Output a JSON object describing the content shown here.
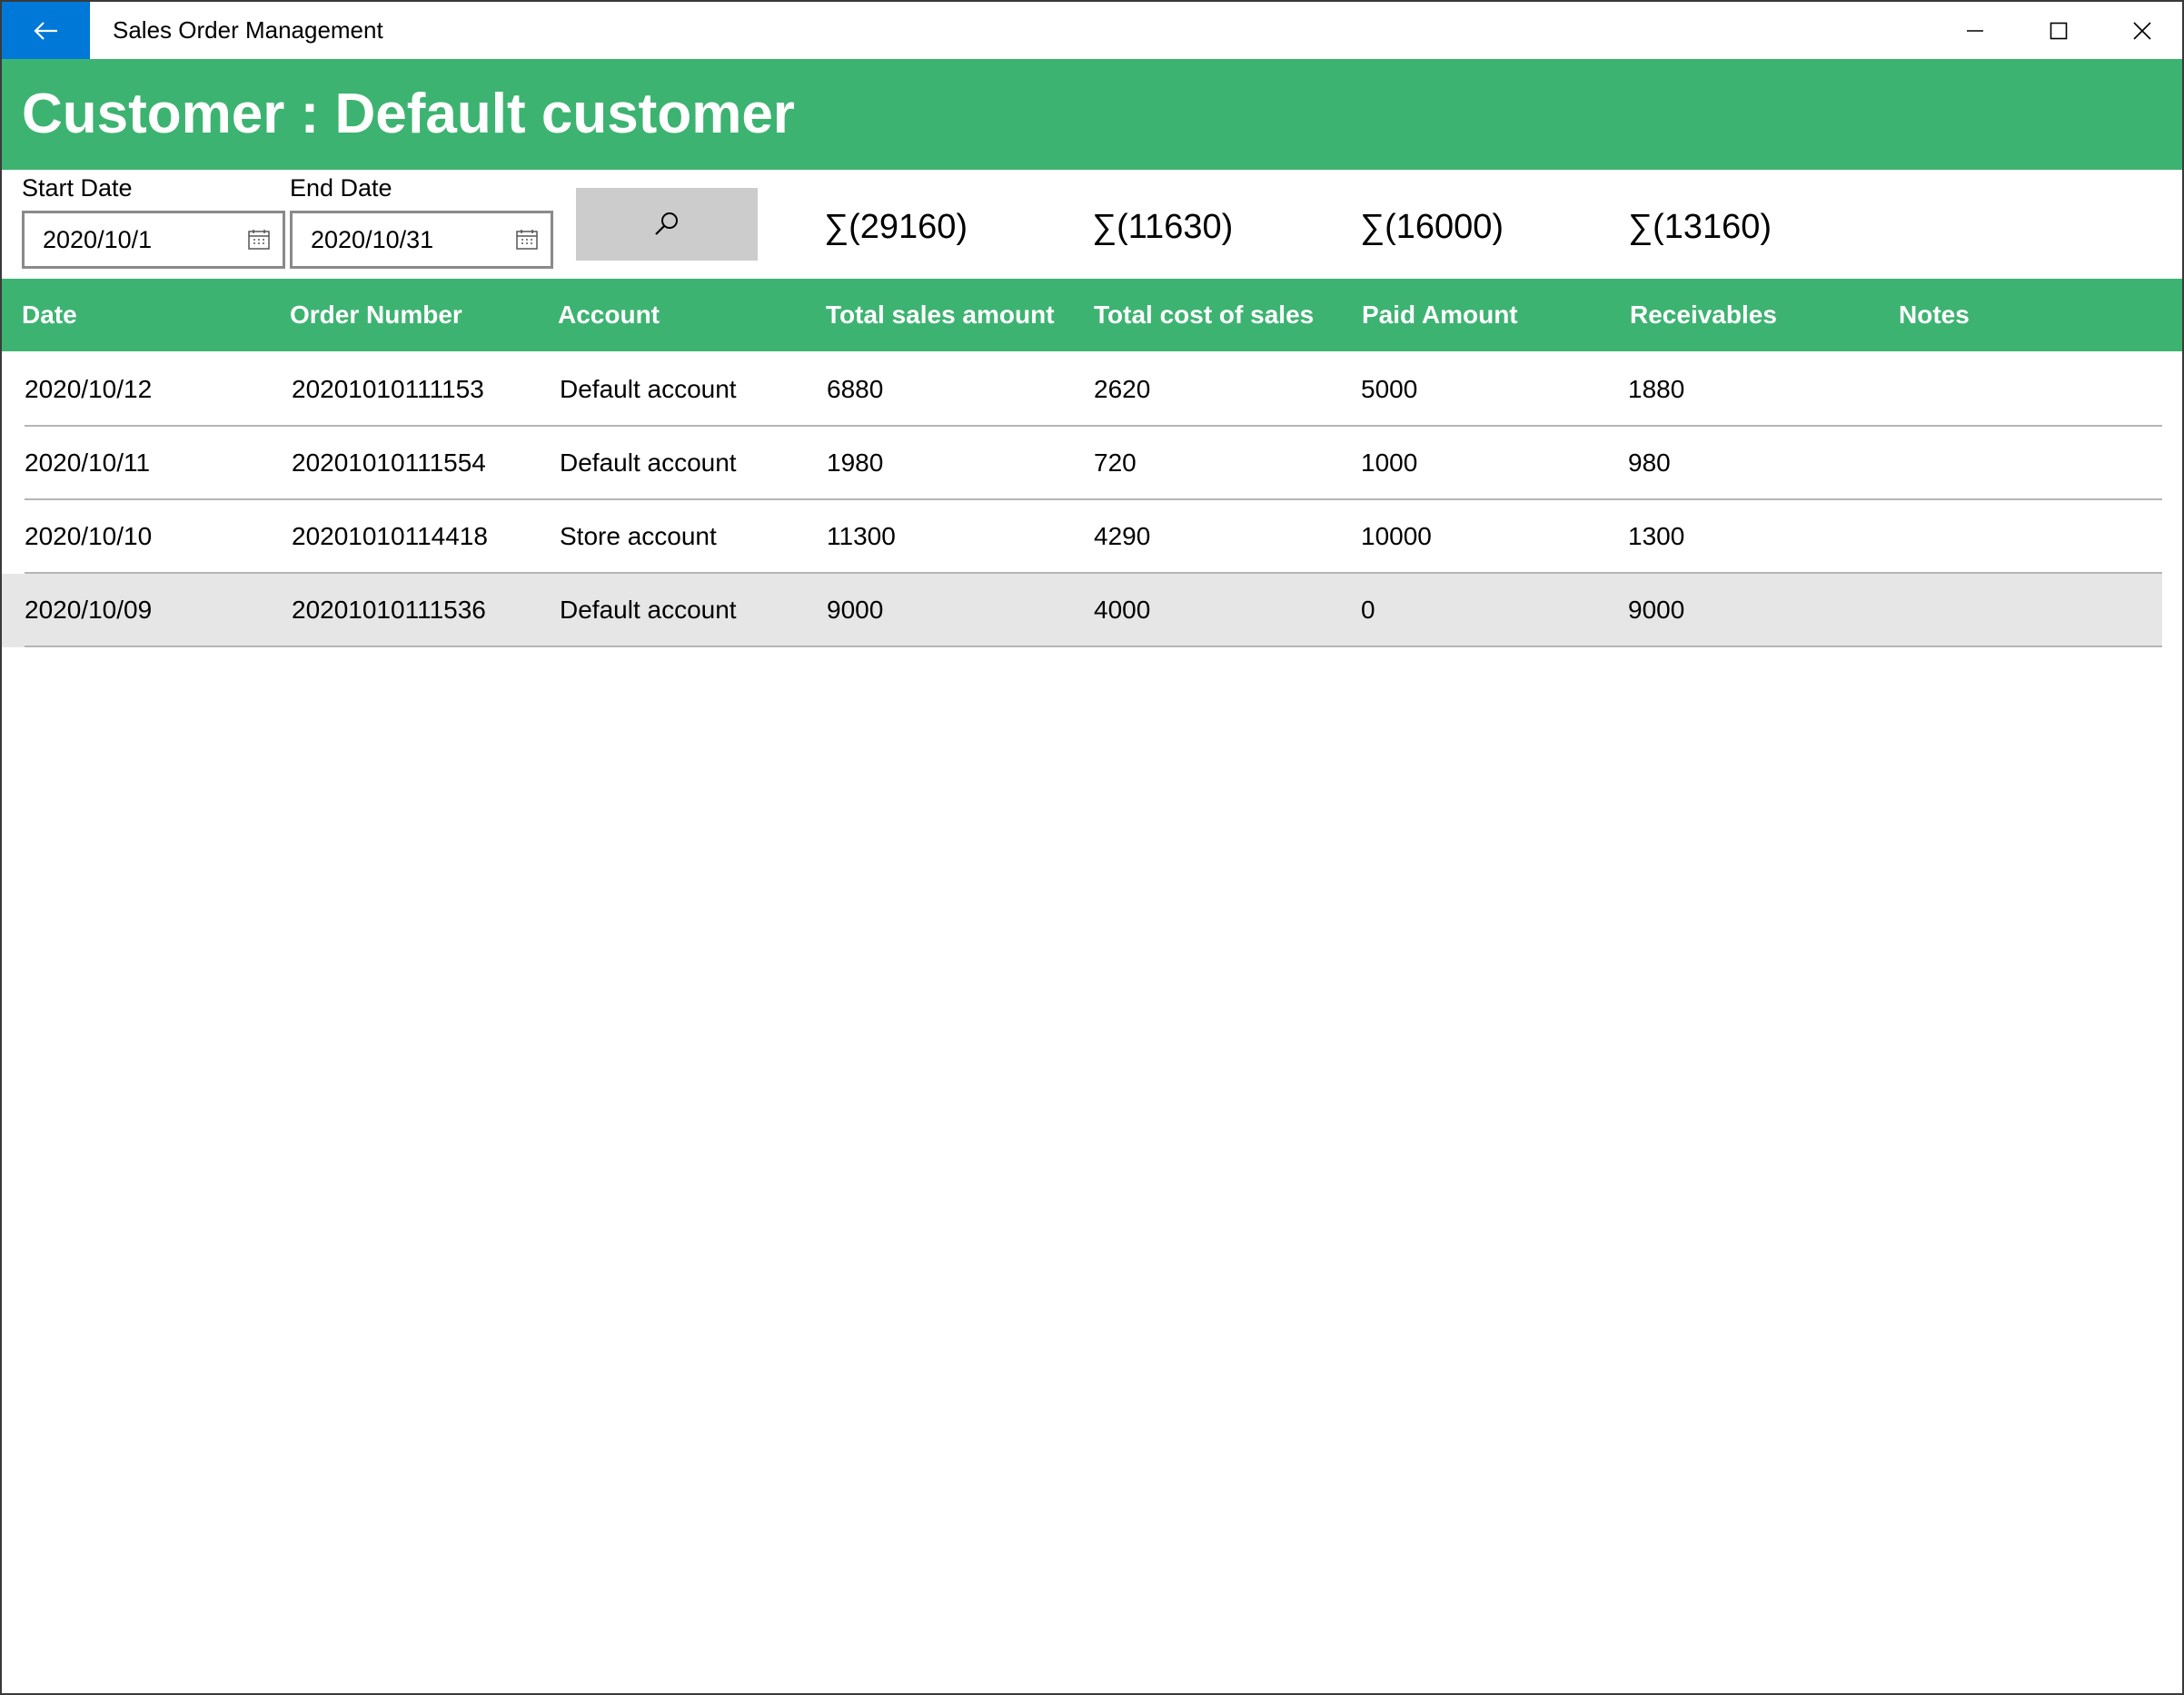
{
  "window": {
    "app_title": "Sales Order Management"
  },
  "colors": {
    "accent": "#3db371",
    "back_button": "#0078d7",
    "selected_row": "#e6e6e6"
  },
  "banner": {
    "title": "Customer : Default customer"
  },
  "filters": {
    "start_label": "Start Date",
    "start_value": "2020/10/1",
    "end_label": "End Date",
    "end_value": "2020/10/31",
    "search_icon": "search-icon",
    "calendar_icon": "calendar-icon"
  },
  "sums": [
    "∑(29160)",
    "∑(11630)",
    "∑(16000)",
    "∑(13160)"
  ],
  "table": {
    "columns": [
      "Date",
      "Order Number",
      "Account",
      "Total sales amount",
      "Total cost of sales",
      "Paid Amount",
      "Receivables",
      "Notes"
    ],
    "rows": [
      {
        "date": "2020/10/12",
        "order": "20201010111153",
        "account": "Default account",
        "sales": "6880",
        "cost": "2620",
        "paid": "5000",
        "receivables": "1880",
        "notes": ""
      },
      {
        "date": "2020/10/11",
        "order": "20201010111554",
        "account": "Default account",
        "sales": "1980",
        "cost": "720",
        "paid": "1000",
        "receivables": "980",
        "notes": ""
      },
      {
        "date": "2020/10/10",
        "order": "20201010114418",
        "account": "Store account",
        "sales": "11300",
        "cost": "4290",
        "paid": "10000",
        "receivables": "1300",
        "notes": ""
      },
      {
        "date": "2020/10/09",
        "order": "20201010111536",
        "account": "Default account",
        "sales": "9000",
        "cost": "4000",
        "paid": "0",
        "receivables": "9000",
        "notes": ""
      }
    ],
    "selected_row": 3
  }
}
